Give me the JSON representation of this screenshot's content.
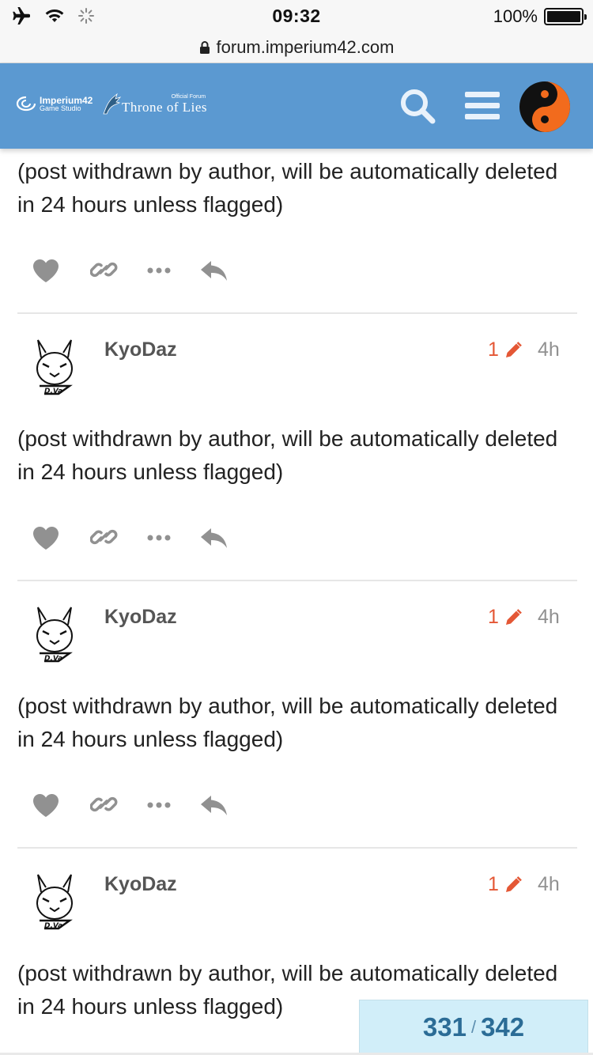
{
  "status_bar": {
    "time": "09:32",
    "battery": "100%",
    "icons": [
      "airplane-icon",
      "wifi-icon",
      "loading-icon"
    ]
  },
  "browser": {
    "url": "forum.imperium42.com",
    "lock_icon": "lock-icon"
  },
  "header": {
    "background_color": "#5b99d1",
    "logo_imperium_main": "Imperium42",
    "logo_imperium_sub": "Game Studio",
    "logo_forum_sub": "Official Forum",
    "logo_forum_main": "Throne of Lies",
    "search_icon": "search-icon",
    "menu_icon": "hamburger-menu-icon",
    "avatar": "yin-yang-avatar"
  },
  "first_post": {
    "body": "(post withdrawn by author, will be automatically deleted in 24 hours unless flagged)"
  },
  "posts": [
    {
      "username": "KyoDaz",
      "edit_count": "1",
      "age": "4h",
      "body": "(post withdrawn by author, will be automatically deleted in 24 hours unless flagged)"
    },
    {
      "username": "KyoDaz",
      "edit_count": "1",
      "age": "4h",
      "body": "(post withdrawn by author, will be automatically deleted in 24 hours unless flagged)"
    },
    {
      "username": "KyoDaz",
      "edit_count": "1",
      "age": "4h",
      "body": "(post withdrawn by author, will be automatically deleted in 24 hours unless flagged)"
    }
  ],
  "post_actions": [
    "like-heart-icon",
    "share-link-icon",
    "more-dots-icon",
    "reply-arrow-icon"
  ],
  "progress": {
    "current": "331",
    "separator": "/",
    "total": "342"
  },
  "colors": {
    "accent_edit": "#e45735",
    "progress_bg": "#d1eef9",
    "progress_text": "#2b6c96"
  }
}
